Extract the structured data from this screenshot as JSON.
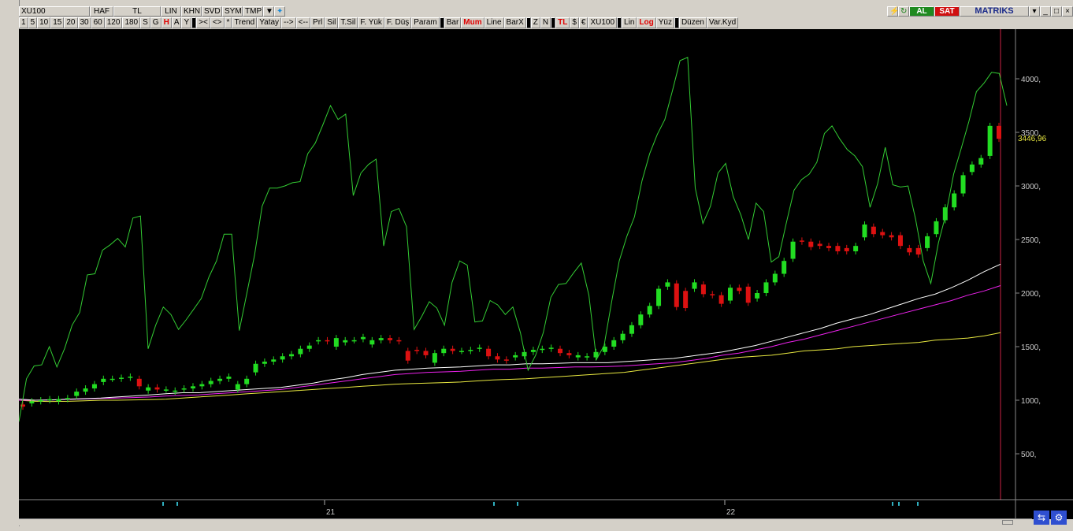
{
  "toolbar_top": {
    "symbol": "XU100",
    "items": [
      "HAF",
      "TL",
      "LIN",
      "KHN",
      "SVD",
      "SYM",
      "TMP"
    ],
    "buttons": {
      "al": "AL",
      "sat": "SAT",
      "brand": "MATRIKS"
    }
  },
  "toolbar_periods": [
    "1",
    "5",
    "10",
    "15",
    "20",
    "30",
    "60",
    "120",
    "180",
    "S",
    "G",
    "H",
    "A",
    "Y"
  ],
  "toolbar_actions": [
    "><",
    "<>",
    "*",
    "Trend",
    "Yatay",
    "-->",
    "<--",
    "Prl",
    "Sil",
    "T.Sil",
    "F. Yük",
    "F. Düş",
    "Param"
  ],
  "toolbar_modes": [
    "Bar",
    "Mum",
    "Line",
    "BarX",
    "Z",
    "N",
    "TL",
    "$",
    "€",
    "XU100",
    "Lin",
    "Log",
    "Yüz",
    "Düzen",
    "Var.Kyd"
  ],
  "chart_data": {
    "type": "line",
    "price_label": "3446,96",
    "yticks": [
      "4000,",
      "3500,",
      "3000,",
      "2500,",
      "2000,",
      "1500,",
      "1000,",
      "500,"
    ],
    "ytick_values": [
      4000,
      3500,
      3000,
      2500,
      2000,
      1500,
      1000,
      500
    ],
    "xtick_labels": [
      "21",
      "22"
    ],
    "candles": [
      [
        960,
        940
      ],
      [
        970,
        990
      ],
      [
        990,
        1000
      ],
      [
        1000,
        1010
      ],
      [
        990,
        1010
      ],
      [
        1010,
        1020
      ],
      [
        1040,
        1080
      ],
      [
        1080,
        1110
      ],
      [
        1110,
        1150
      ],
      [
        1170,
        1200
      ],
      [
        1200,
        1200
      ],
      [
        1200,
        1210
      ],
      [
        1210,
        1220
      ],
      [
        1200,
        1130
      ],
      [
        1090,
        1120
      ],
      [
        1120,
        1100
      ],
      [
        1100,
        1100
      ],
      [
        1080,
        1090
      ],
      [
        1100,
        1110
      ],
      [
        1110,
        1130
      ],
      [
        1130,
        1150
      ],
      [
        1150,
        1180
      ],
      [
        1180,
        1200
      ],
      [
        1200,
        1220
      ],
      [
        1100,
        1150
      ],
      [
        1150,
        1200
      ],
      [
        1260,
        1340
      ],
      [
        1340,
        1360
      ],
      [
        1360,
        1380
      ],
      [
        1380,
        1410
      ],
      [
        1410,
        1430
      ],
      [
        1430,
        1480
      ],
      [
        1480,
        1510
      ],
      [
        1550,
        1560
      ],
      [
        1560,
        1550
      ],
      [
        1500,
        1580
      ],
      [
        1540,
        1560
      ],
      [
        1560,
        1560
      ],
      [
        1570,
        1590
      ],
      [
        1520,
        1560
      ],
      [
        1560,
        1580
      ],
      [
        1580,
        1560
      ],
      [
        1560,
        1550
      ],
      [
        1460,
        1370
      ],
      [
        1470,
        1460
      ],
      [
        1460,
        1420
      ],
      [
        1350,
        1440
      ],
      [
        1440,
        1480
      ],
      [
        1480,
        1460
      ],
      [
        1460,
        1460
      ],
      [
        1460,
        1470
      ],
      [
        1480,
        1490
      ],
      [
        1480,
        1410
      ],
      [
        1410,
        1380
      ],
      [
        1380,
        1370
      ],
      [
        1400,
        1420
      ],
      [
        1410,
        1450
      ],
      [
        1450,
        1470
      ],
      [
        1470,
        1480
      ],
      [
        1480,
        1490
      ],
      [
        1480,
        1440
      ],
      [
        1440,
        1420
      ],
      [
        1400,
        1420
      ],
      [
        1400,
        1410
      ],
      [
        1400,
        1450
      ],
      [
        1450,
        1500
      ],
      [
        1500,
        1560
      ],
      [
        1560,
        1620
      ],
      [
        1620,
        1700
      ],
      [
        1700,
        1800
      ],
      [
        1800,
        1880
      ],
      [
        1880,
        2040
      ],
      [
        2060,
        2100
      ],
      [
        2090,
        1870
      ],
      [
        2020,
        1860
      ],
      [
        2040,
        2100
      ],
      [
        2080,
        1990
      ],
      [
        1990,
        1980
      ],
      [
        1980,
        1900
      ],
      [
        1930,
        2050
      ],
      [
        2050,
        2020
      ],
      [
        2060,
        1910
      ],
      [
        1950,
        2000
      ],
      [
        2000,
        2100
      ],
      [
        2100,
        2180
      ],
      [
        2180,
        2300
      ],
      [
        2320,
        2480
      ],
      [
        2490,
        2480
      ],
      [
        2480,
        2430
      ],
      [
        2460,
        2440
      ],
      [
        2440,
        2420
      ],
      [
        2440,
        2390
      ],
      [
        2420,
        2390
      ],
      [
        2390,
        2440
      ],
      [
        2520,
        2640
      ],
      [
        2620,
        2550
      ],
      [
        2570,
        2540
      ],
      [
        2540,
        2520
      ],
      [
        2540,
        2440
      ],
      [
        2420,
        2380
      ],
      [
        2420,
        2360
      ],
      [
        2420,
        2530
      ],
      [
        2550,
        2670
      ],
      [
        2680,
        2800
      ],
      [
        2800,
        2930
      ],
      [
        2930,
        3100
      ],
      [
        3130,
        3200
      ],
      [
        3200,
        3260
      ],
      [
        3280,
        3560
      ],
      [
        3560,
        3440
      ]
    ],
    "green_line": [
      800,
      1200,
      1320,
      1330,
      1500,
      1310,
      1480,
      1700,
      1820,
      2170,
      2180,
      2400,
      2450,
      2510,
      2430,
      2700,
      2720,
      1480,
      1700,
      1870,
      1800,
      1660,
      1750,
      1850,
      1950,
      2150,
      2300,
      2550,
      2550,
      1650,
      2000,
      2350,
      2810,
      2980,
      2980,
      3000,
      3030,
      3040,
      3300,
      3400,
      3570,
      3750,
      3620,
      3670,
      2910,
      3120,
      3200,
      3250,
      2440,
      2760,
      2790,
      2620,
      1660,
      1780,
      1920,
      1860,
      1700,
      2100,
      2300,
      2260,
      1730,
      1740,
      1930,
      1890,
      1800,
      1870,
      1630,
      1280,
      1420,
      1630,
      1960,
      2080,
      2090,
      2190,
      2280,
      1980,
      1380,
      1510,
      1920,
      2300,
      2530,
      2710,
      3050,
      3300,
      3480,
      3620,
      3890,
      4170,
      4200,
      2980,
      2650,
      2810,
      3120,
      3210,
      2900,
      2730,
      2500,
      2840,
      2760,
      2290,
      2340,
      2660,
      2960,
      3060,
      3110,
      3220,
      3490,
      3560,
      3440,
      3340,
      3280,
      3180,
      2800,
      3020,
      3360,
      3010,
      2990,
      3000,
      2690,
      2300,
      2090,
      2470,
      2740,
      3110,
      3350,
      3600,
      3880,
      3960,
      4060,
      4050,
      3750
    ],
    "white_ma": [
      1010,
      1000,
      1003,
      1010,
      1015,
      1020,
      1030,
      1040,
      1050,
      1060,
      1070,
      1070,
      1080,
      1090,
      1100,
      1110,
      1120,
      1140,
      1160,
      1190,
      1210,
      1240,
      1260,
      1280,
      1290,
      1300,
      1305,
      1310,
      1320,
      1330,
      1330,
      1340,
      1340,
      1345,
      1350,
      1350,
      1350,
      1360,
      1370,
      1380,
      1390,
      1410,
      1430,
      1450,
      1480,
      1510,
      1550,
      1590,
      1630,
      1670,
      1720,
      1760,
      1800,
      1850,
      1900,
      1950,
      1990,
      2050,
      2120,
      2200,
      2270
    ],
    "magenta_ma": [
      1000,
      1000,
      1002,
      1007,
      1012,
      1017,
      1020,
      1025,
      1030,
      1040,
      1045,
      1050,
      1060,
      1070,
      1080,
      1090,
      1100,
      1120,
      1140,
      1160,
      1180,
      1200,
      1220,
      1240,
      1250,
      1260,
      1265,
      1270,
      1280,
      1290,
      1290,
      1300,
      1300,
      1305,
      1310,
      1310,
      1315,
      1320,
      1330,
      1340,
      1350,
      1370,
      1390,
      1420,
      1440,
      1470,
      1500,
      1540,
      1570,
      1610,
      1650,
      1690,
      1730,
      1770,
      1810,
      1850,
      1890,
      1930,
      1980,
      2020,
      2070
    ],
    "yellow_ma": [
      1000,
      990,
      988,
      990,
      995,
      1000,
      1000,
      1003,
      1006,
      1010,
      1020,
      1030,
      1040,
      1050,
      1060,
      1070,
      1080,
      1090,
      1100,
      1110,
      1120,
      1130,
      1140,
      1150,
      1155,
      1160,
      1165,
      1170,
      1180,
      1190,
      1195,
      1200,
      1210,
      1220,
      1230,
      1240,
      1250,
      1260,
      1280,
      1300,
      1320,
      1340,
      1360,
      1380,
      1400,
      1410,
      1420,
      1440,
      1460,
      1470,
      1480,
      1500,
      1510,
      1520,
      1530,
      1540,
      1560,
      1570,
      1580,
      1600,
      1630
    ],
    "colors": {
      "bg": "#000000",
      "up": "#22dd22",
      "down": "#dd1111",
      "green_line": "#33cc33",
      "white": "#ffffff",
      "magenta": "#ee22ee",
      "yellow": "#e8e840",
      "axis_text": "#cccccc",
      "price_label": "#e8e840",
      "vline": "#cc2244"
    }
  }
}
